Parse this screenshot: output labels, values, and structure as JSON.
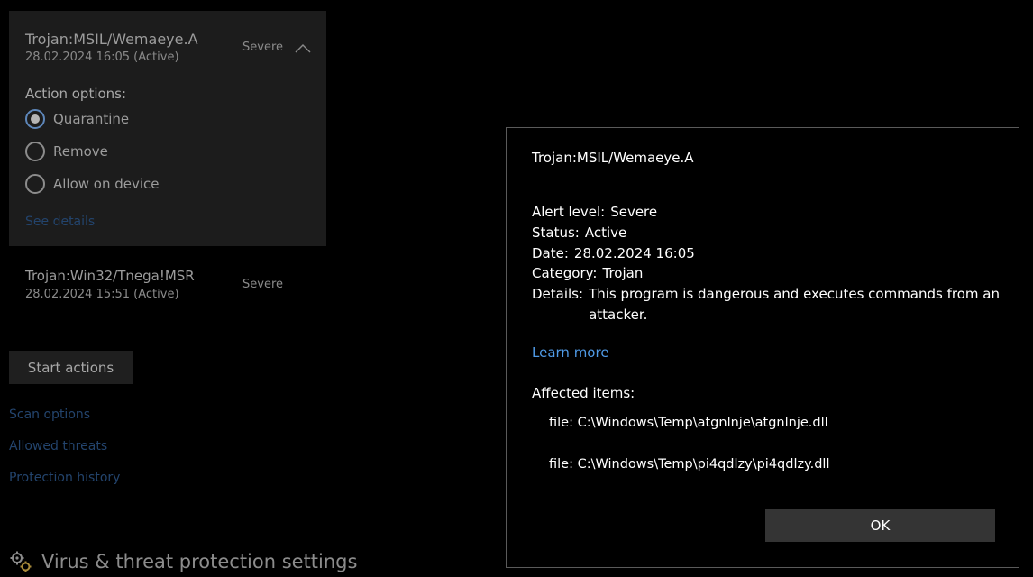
{
  "threats": [
    {
      "name": "Trojan:MSIL/Wemaeye.A",
      "date": "28.02.2024 16:05 (Active)",
      "severity": "Severe"
    },
    {
      "name": "Trojan:Win32/Tnega!MSR",
      "date": "28.02.2024 15:51 (Active)",
      "severity": "Severe"
    }
  ],
  "action_options": {
    "label": "Action options:",
    "options": [
      "Quarantine",
      "Remove",
      "Allow on device"
    ],
    "selected": "Quarantine"
  },
  "see_details": "See details",
  "start_actions": "Start actions",
  "links": [
    "Scan options",
    "Allowed threats",
    "Protection history"
  ],
  "settings": {
    "label": "Virus & threat protection settings",
    "icon": "gears-icon"
  },
  "dialog": {
    "title": "Trojan:MSIL/Wemaeye.A",
    "details": [
      {
        "key": "Alert level:",
        "value": "Severe"
      },
      {
        "key": "Status:",
        "value": "Active"
      },
      {
        "key": "Date:",
        "value": "28.02.2024 16:05"
      },
      {
        "key": "Category:",
        "value": "Trojan"
      },
      {
        "key": "Details:",
        "value": "This program is dangerous and executes commands from an attacker."
      }
    ],
    "learn_more": "Learn more",
    "affected_label": "Affected items:",
    "affected_items": [
      "file: C:\\Windows\\Temp\\atgnlnje\\atgnlnje.dll",
      "file: C:\\Windows\\Temp\\pi4qdlzy\\pi4qdlzy.dll"
    ],
    "ok_label": "OK"
  },
  "colors": {
    "link": "#4f9ae6",
    "dim_link": "#23446d",
    "card_bg": "#1c1c1c"
  }
}
